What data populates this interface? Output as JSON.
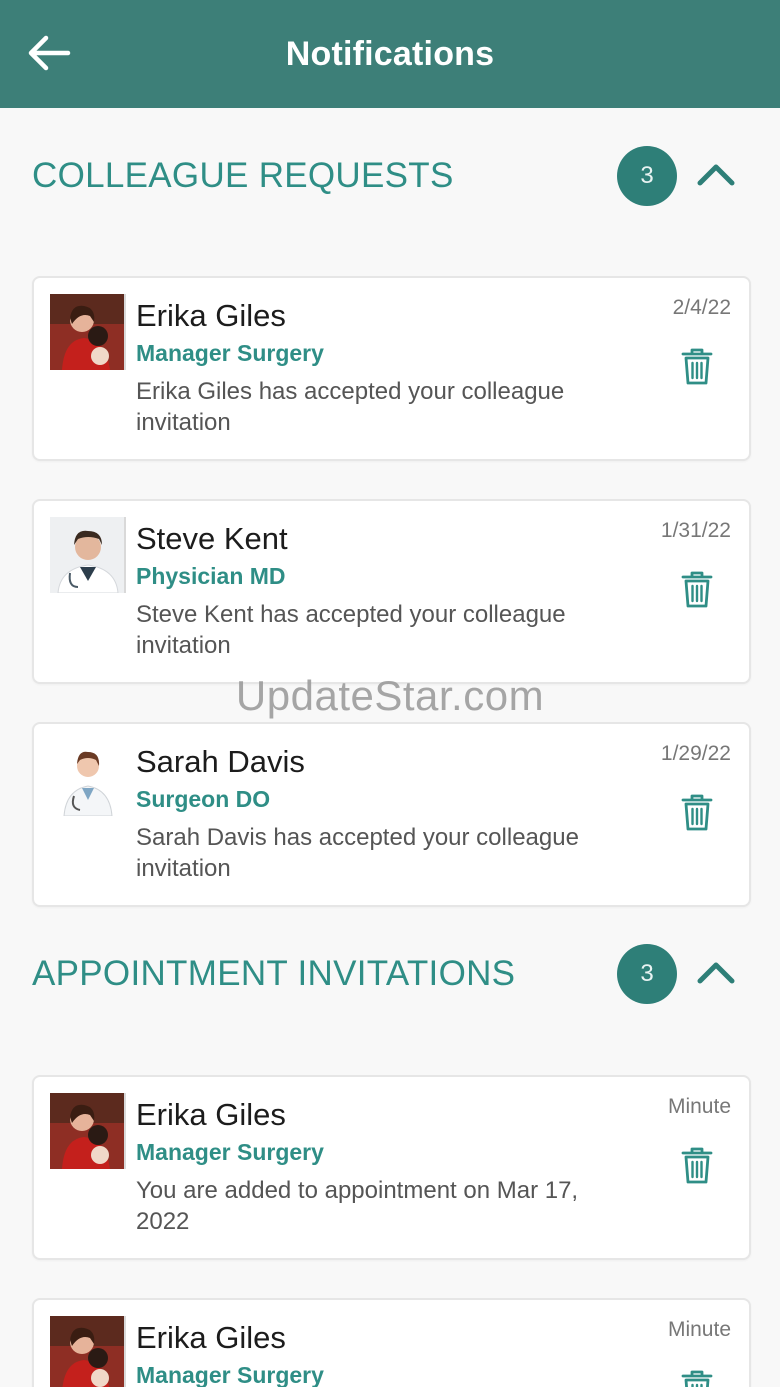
{
  "header": {
    "title": "Notifications",
    "back_icon": "arrow-left-icon"
  },
  "colors": {
    "header_bg": "#3d7f78",
    "accent": "#2f8e86",
    "badge": "#2e7f78"
  },
  "sections": [
    {
      "title": "COLLEAGUE REQUESTS",
      "count": "3",
      "collapse_icon": "chevron-up-icon",
      "items": [
        {
          "avatar": "erika-giles-photo",
          "name": "Erika Giles",
          "role": "Manager Surgery",
          "message": "Erika Giles has accepted your colleague invitation",
          "date": "2/4/22"
        },
        {
          "avatar": "steve-kent-photo",
          "name": "Steve Kent",
          "role": "Physician MD",
          "message": "Steve Kent has accepted your colleague invitation",
          "date": "1/31/22"
        },
        {
          "avatar": "sarah-davis-photo",
          "name": "Sarah Davis",
          "role": "Surgeon DO",
          "message": "Sarah Davis has accepted your colleague invitation",
          "date": "1/29/22"
        }
      ]
    },
    {
      "title": "APPOINTMENT INVITATIONS",
      "count": "3",
      "collapse_icon": "chevron-up-icon",
      "items": [
        {
          "avatar": "erika-giles-photo",
          "name": "Erika Giles",
          "role": "Manager Surgery",
          "message": "You are added to appointment on Mar 17, 2022",
          "date": "Minute"
        },
        {
          "avatar": "erika-giles-photo",
          "name": "Erika Giles",
          "role": "Manager Surgery",
          "message": "",
          "date": "Minute"
        }
      ]
    }
  ],
  "watermark": "UpdateStar.com"
}
